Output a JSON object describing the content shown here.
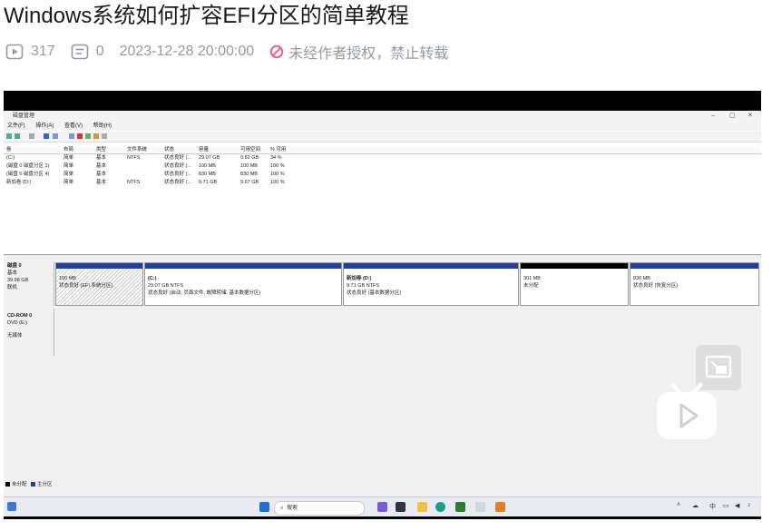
{
  "header": {
    "title": "Windows系统如何扩容EFI分区的简单教程",
    "views": "317",
    "comments": "0",
    "datetime": "2023-12-28 20:00:00",
    "copyright_notice": "未经作者授权，禁止转载"
  },
  "colors": {
    "accent": "#fb7299",
    "warning": "#f25d8e",
    "meta_gray": "#9499a0",
    "primary_partition": "#1f3d9c"
  },
  "video": {
    "window_title": "磁盘管理",
    "menu": [
      "文件(F)",
      "操作(A)",
      "查看(V)",
      "帮助(H)"
    ],
    "columns": [
      "卷",
      "布局",
      "类型",
      "文件系统",
      "状态",
      "容量",
      "可用空间",
      "% 可用"
    ],
    "rows": [
      [
        "(C:)",
        "简单",
        "基本",
        "NTFS",
        "状态良好 (...",
        "29.07 GB",
        "9.82 GB",
        "34 %"
      ],
      [
        "(磁盘 0 磁盘分区 1)",
        "简单",
        "基本",
        "",
        "状态良好 (...",
        "100 MB",
        "100 MB",
        "100 %"
      ],
      [
        "(磁盘 0 磁盘分区 4)",
        "简单",
        "基本",
        "",
        "状态良好 (...",
        "830 MB",
        "830 MB",
        "100 %"
      ],
      [
        "新加卷 (D:)",
        "简单",
        "基本",
        "NTFS",
        "状态良好 (...",
        "9.71 GB",
        "9.67 GB",
        "100 %"
      ]
    ],
    "disk0": {
      "name": "磁盘 0",
      "type": "基本",
      "size": "39.98 GB",
      "status": "联机"
    },
    "partitions": [
      {
        "name": "",
        "size": "100 MB",
        "status": "状态良好 (EFI 系统分区)",
        "kind": "primary",
        "hatched": true
      },
      {
        "name": "(C:)",
        "size": "29.07 GB NTFS",
        "status": "状态良好 (启动, 页面文件, 故障转储, 基本数据分区)",
        "kind": "primary",
        "hatched": false
      },
      {
        "name": "新加卷 (D:)",
        "size": "9.71 GB NTFS",
        "status": "状态良好 (基本数据分区)",
        "kind": "primary",
        "hatched": false
      },
      {
        "name": "",
        "size": "301 MB",
        "status": "未分配",
        "kind": "unallocated",
        "hatched": false
      },
      {
        "name": "",
        "size": "830 MB",
        "status": "状态良好 (恢复分区)",
        "kind": "primary",
        "hatched": false
      }
    ],
    "cdrom": {
      "name": "CD-ROM 0",
      "drive": "DVD (E:)",
      "media": "无媒体"
    },
    "legend": [
      "未分配",
      "主分区"
    ],
    "taskbar": {
      "search_placeholder": "搜索",
      "tray_ime": "中"
    }
  }
}
